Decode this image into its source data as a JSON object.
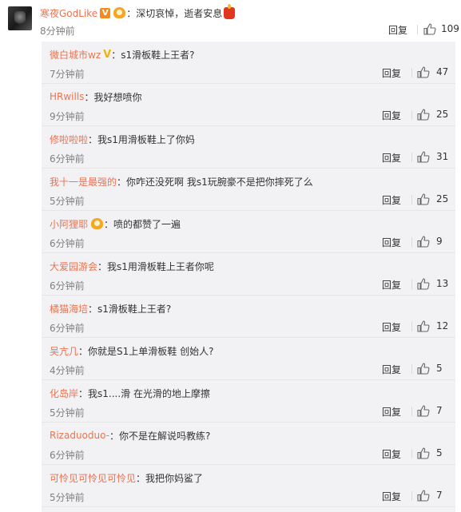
{
  "comment": {
    "username": "寒夜GodLike",
    "separator": "：",
    "text": "深切哀悼，逝者安息",
    "time": "8分钟前",
    "reply_label": "回复",
    "likes": "109"
  },
  "replies": [
    {
      "username": "微白城市wz",
      "separator": "：",
      "text": "s1滑板鞋上王者?",
      "time": "7分钟前",
      "reply_label": "回复",
      "likes": "47"
    },
    {
      "username": "HRwills",
      "separator": "：",
      "text": "我好想喷你",
      "time": "9分钟前",
      "reply_label": "回复",
      "likes": "25"
    },
    {
      "username": "修啦啦啦",
      "separator": "：",
      "text": "我s1用滑板鞋上了你妈",
      "time": "6分钟前",
      "reply_label": "回复",
      "likes": "31"
    },
    {
      "username": "我十一是最强的",
      "separator": "：",
      "text": "你咋还没死啊 我s1玩腕豪不是把你摔死了么",
      "time": "5分钟前",
      "reply_label": "回复",
      "likes": "25"
    },
    {
      "username": "小阿狸耶",
      "separator": "：",
      "text": "喷的都赞了一遍",
      "time": "6分钟前",
      "reply_label": "回复",
      "likes": "9"
    },
    {
      "username": "大爱园游会",
      "separator": "：",
      "text": "我s1用滑板鞋上王者你呢",
      "time": "6分钟前",
      "reply_label": "回复",
      "likes": "13"
    },
    {
      "username": "橘猫海培",
      "separator": "：",
      "text": "s1滑板鞋上王者?",
      "time": "6分钟前",
      "reply_label": "回复",
      "likes": "12"
    },
    {
      "username": "吴亢几",
      "separator": "：",
      "text": "你就是S1上单滑板鞋 创始人?",
      "time": "4分钟前",
      "reply_label": "回复",
      "likes": "5"
    },
    {
      "username": "化岛岸",
      "separator": "：",
      "text": "我s1....滑  在光滑的地上摩擦",
      "time": "5分钟前",
      "reply_label": "回复",
      "likes": "7"
    },
    {
      "username": "Rizaduoduo-",
      "separator": "：",
      "text": "你不是在解说吗教练?",
      "time": "6分钟前",
      "reply_label": "回复",
      "likes": "5"
    },
    {
      "username": "可怜见可怜见可怜见",
      "separator": "：",
      "text": "我把你妈鲨了",
      "time": "5分钟前",
      "reply_label": "回复",
      "likes": "7"
    }
  ],
  "colors": {
    "username": "#eb7350",
    "text": "#333333",
    "time": "#808080",
    "reply_bg": "#f2f2f5"
  },
  "icons": {
    "like": "thumbs-up-icon",
    "vip": "vip-badge-icon",
    "verified": "gold-v-icon",
    "medal": "medal-badge-icon",
    "candle": "candle-emoji"
  }
}
